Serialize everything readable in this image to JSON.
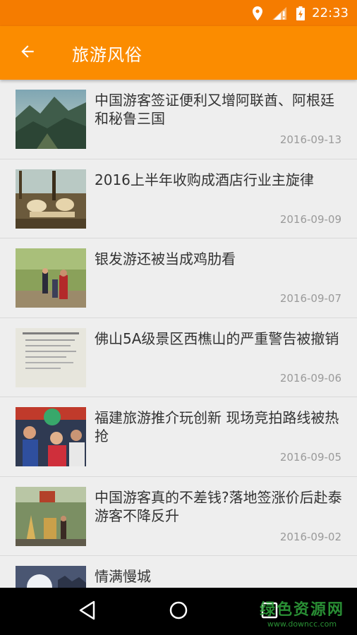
{
  "status_bar": {
    "time": "22:33",
    "icons": [
      "location-icon",
      "signal-icon",
      "battery-charging-icon"
    ]
  },
  "app_bar": {
    "back_icon": "arrow-left-icon",
    "title": "旅游风俗"
  },
  "articles": [
    {
      "title": "中国游客签证便利又增阿联酋、阿根廷和秘鲁三国",
      "date": "2016-09-13"
    },
    {
      "title": "2016上半年收购成酒店行业主旋律",
      "date": "2016-09-09"
    },
    {
      "title": "银发游还被当成鸡肋看",
      "date": "2016-09-07"
    },
    {
      "title": "佛山5A级景区西樵山的严重警告被撤销",
      "date": "2016-09-06"
    },
    {
      "title": "福建旅游推介玩创新 现场竞拍路线被热抢",
      "date": "2016-09-05"
    },
    {
      "title": "中国游客真的不差钱?落地签涨价后赴泰游客不降反升",
      "date": "2016-09-02"
    },
    {
      "title": "情满慢城",
      "date": ""
    }
  ],
  "nav_bar": {
    "icons": [
      "back-triangle-icon",
      "home-circle-icon",
      "recents-square-icon"
    ]
  },
  "watermark": {
    "title": "绿色资源网",
    "url": "www.downcc.com"
  },
  "colors": {
    "status_bar": "#f57c00",
    "app_bar": "#fb8c00",
    "background": "#eeeeee"
  }
}
